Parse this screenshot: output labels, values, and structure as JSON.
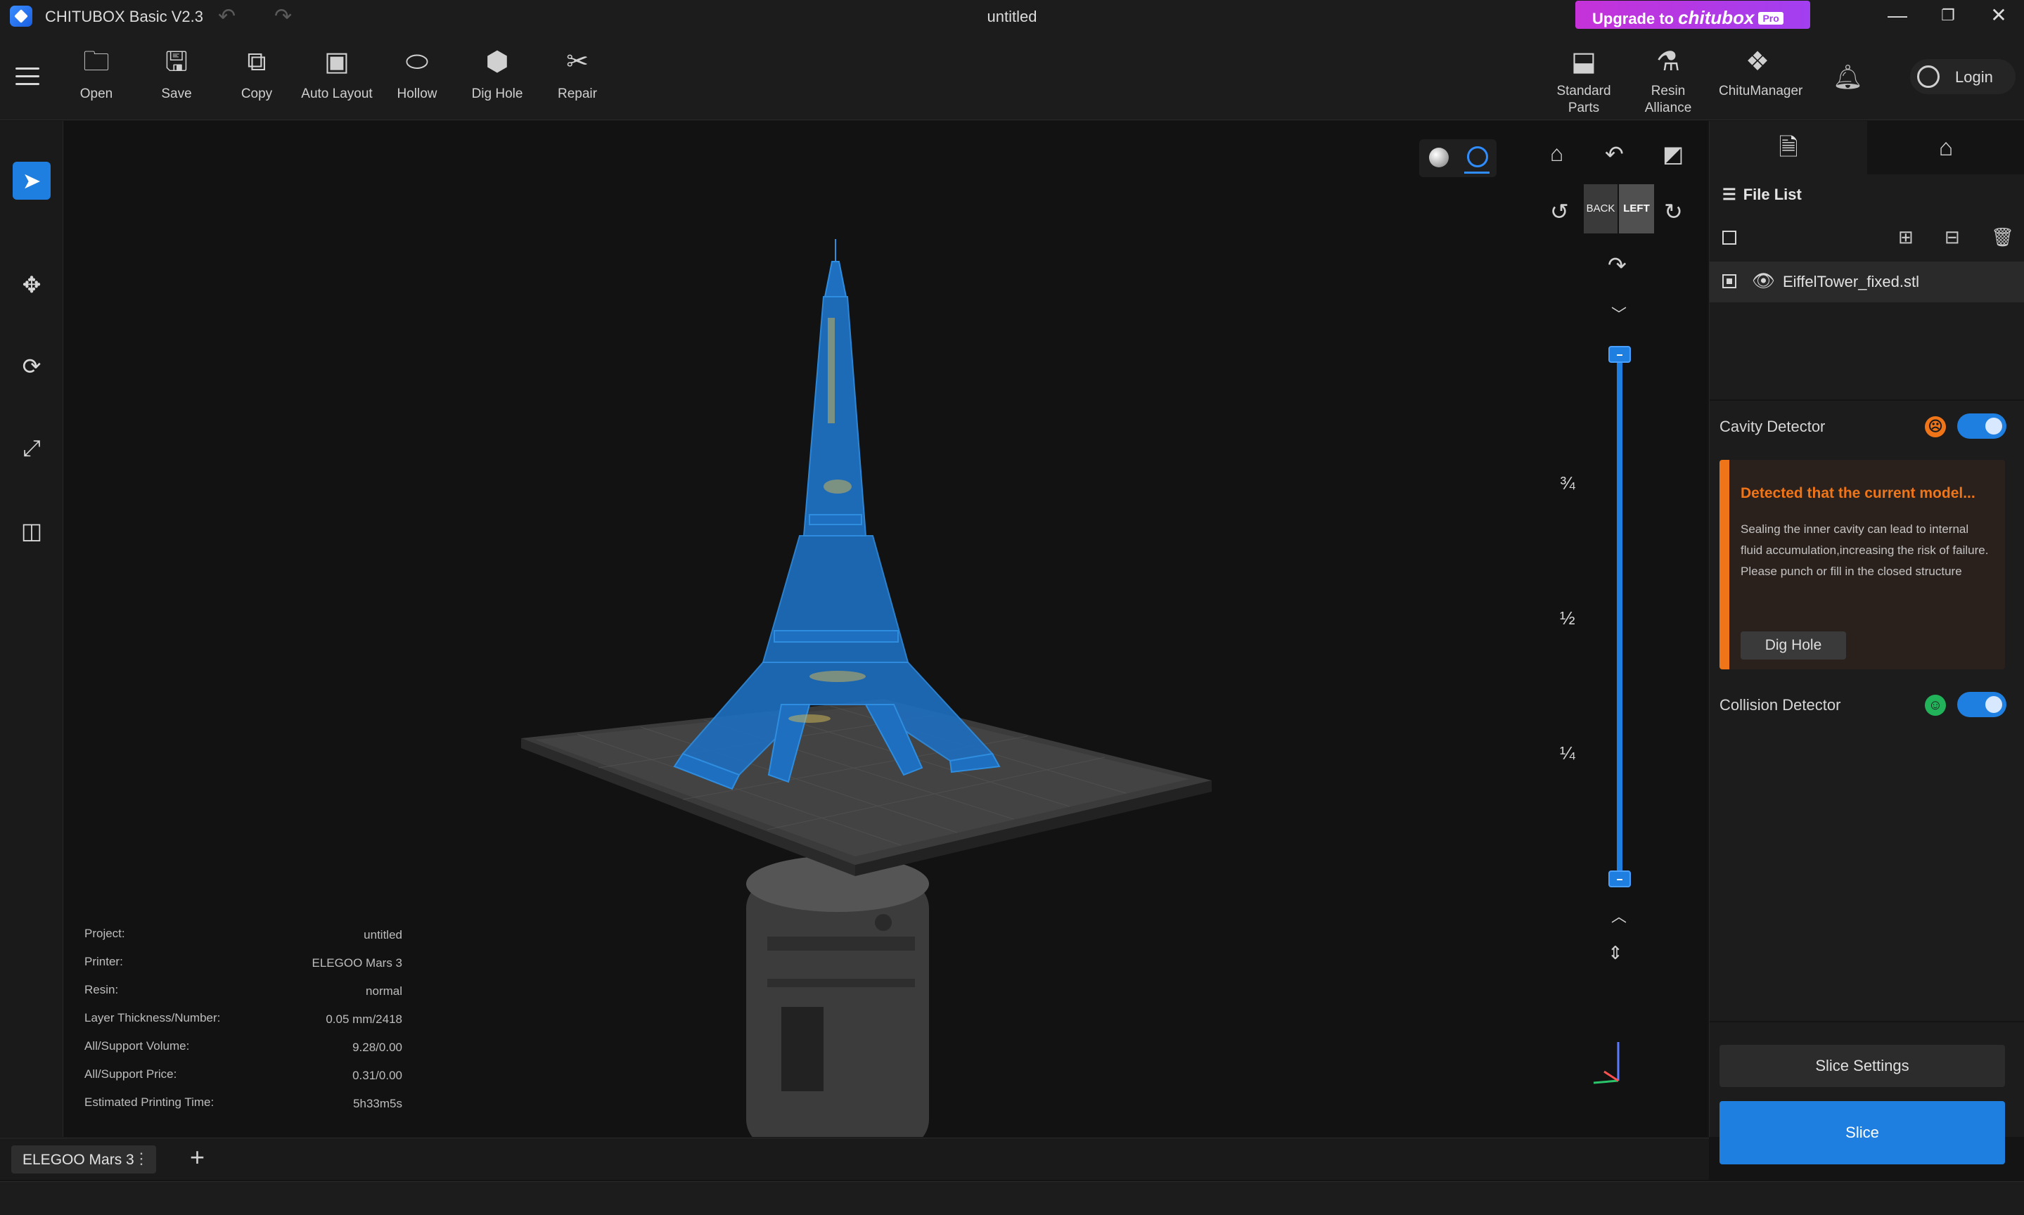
{
  "titlebar": {
    "app_name": "CHITUBOX Basic V2.3",
    "doc_title": "untitled",
    "upgrade": {
      "prefix": "Upgrade to",
      "brand": "chitubox",
      "badge": "Pro"
    },
    "undo_icon": "undo-icon",
    "redo_icon": "redo-icon"
  },
  "toolbar": {
    "left_tools": [
      {
        "label": "Open",
        "icon": "folder-icon"
      },
      {
        "label": "Save",
        "icon": "save-icon"
      },
      {
        "label": "Copy",
        "icon": "copy-icon"
      },
      {
        "label": "Auto Layout",
        "icon": "auto-layout-icon"
      },
      {
        "label": "Hollow",
        "icon": "hollow-icon"
      },
      {
        "label": "Dig Hole",
        "icon": "dig-hole-icon"
      },
      {
        "label": "Repair",
        "icon": "repair-icon"
      }
    ],
    "right_tools": [
      {
        "label": "Standard\nParts",
        "line1": "Standard",
        "line2": "Parts",
        "icon": "standard-parts-icon"
      },
      {
        "label": "Resin Alliance",
        "icon": "resin-alliance-icon"
      },
      {
        "label": "ChituManager",
        "icon": "chitumanager-icon"
      }
    ],
    "login_label": "Login"
  },
  "viewport": {
    "cube_back": "BACK",
    "cube_left": "LEFT",
    "fractions": [
      "¾",
      "½",
      "¼"
    ],
    "layer_slider": {
      "top": 1.0,
      "bottom": 0.0
    }
  },
  "project_info": [
    {
      "key": "Project:",
      "value": "untitled"
    },
    {
      "key": "Printer:",
      "value": "ELEGOO Mars 3"
    },
    {
      "key": "Resin:",
      "value": "normal"
    },
    {
      "key": "Layer Thickness/Number:",
      "value": "0.05 mm/2418"
    },
    {
      "key": "All/Support Volume:",
      "value": "9.28/0.00"
    },
    {
      "key": "All/Support Price:",
      "value": "0.31/0.00"
    },
    {
      "key": "Estimated Printing Time:",
      "value": "5h33m5s"
    }
  ],
  "right_panel": {
    "file_list_title": "File List",
    "files": [
      {
        "name": "EiffelTower_fixed.stl",
        "visible": true
      }
    ],
    "cavity_detector": {
      "label": "Cavity Detector",
      "enabled": true,
      "status_color": "#f07518",
      "warning_title": "Detected that the current model...",
      "warning_text": "Sealing the inner cavity can lead to internal fluid accumulation,increasing the risk of failure. Please punch or fill in the closed structure",
      "action_label": "Dig Hole"
    },
    "collision_detector": {
      "label": "Collision Detector",
      "enabled": true,
      "status_color": "#22b35a"
    },
    "slice_settings_label": "Slice Settings",
    "slice_label": "Slice"
  },
  "bottom": {
    "printer_tab": "ELEGOO Mars 3",
    "add_tab_icon": "plus-icon"
  },
  "colors": {
    "accent": "#1f7fe0",
    "warning": "#f07518",
    "model": "#1e6fc0"
  }
}
